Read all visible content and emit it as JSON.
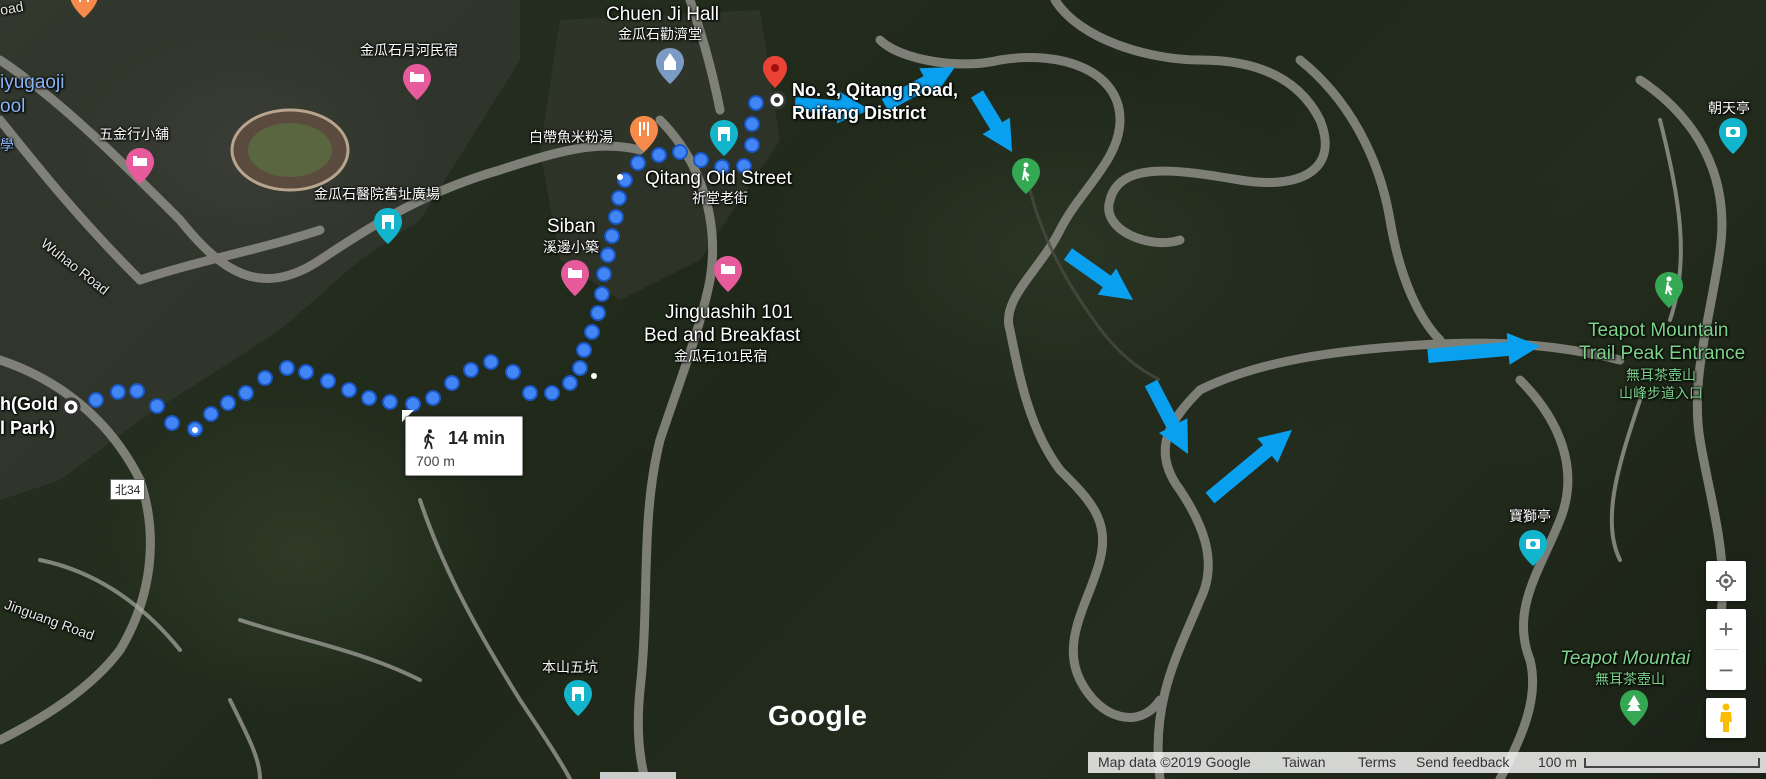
{
  "places": {
    "chuen_ji_hall_en": "Chuen Ji Hall",
    "chuen_ji_hall_zh": "金瓜石勸濟堂",
    "moonriver_zh": "金瓜石月河民宿",
    "yugaoji_a": "iyugaoji",
    "yugaoji_b": "ool",
    "yugaoji_c": "學",
    "wujin_zh": "五金行小舖",
    "hospital_zh": "金瓜石醫院舊址廣場",
    "baidai_zh": "白帶魚米粉湯",
    "qitang_en": "Qitang Old Street",
    "qitang_zh": "祈堂老街",
    "siban_en": "Siban",
    "siban_zh": "溪邊小築",
    "jinguashih101_en_1": "Jinguashih 101",
    "jinguashih101_en_2": "Bed and Breakfast",
    "jinguashih101_zh": "金瓜石101民宿",
    "benshan_zh": "本山五坑",
    "chaotian_zh": "朝天亭",
    "baoshi_zh": "寶獅亭",
    "teapot_entrance_en_1": "Teapot Mountain",
    "teapot_entrance_en_2": "Trail Peak Entrance",
    "teapot_entrance_zh_1": "無耳茶壺山",
    "teapot_entrance_zh_2": "山峰步道入口",
    "teapot_mountain_en": "Teapot Mountai",
    "teapot_mountain_zh": "無耳茶壺山",
    "gold_park_1": "h(Gold",
    "gold_park_2": "l Park)",
    "road_top": "oad",
    "wuhao_road": "Wuhao Road",
    "jinguang_road": "Jinguang Road",
    "route_badge": "北34"
  },
  "destination": {
    "line1": "No. 3, Qitang Road,",
    "line2": "Ruifang District"
  },
  "route": {
    "mode_icon": "walking-icon",
    "duration": "14 min",
    "distance": "700 m",
    "color": "#4285f4"
  },
  "annotation_arrows": {
    "color": "#0aa0f0",
    "count": 8
  },
  "controls": {
    "zoom_in": "+",
    "zoom_out": "−",
    "locate_icon": "my-location-icon",
    "pegman_icon": "pegman-icon"
  },
  "branding": {
    "logo": "Google"
  },
  "footer": {
    "map_data": "Map data ©2019 Google",
    "region": "Taiwan",
    "terms": "Terms",
    "feedback": "Send feedback",
    "scale": "100 m"
  }
}
